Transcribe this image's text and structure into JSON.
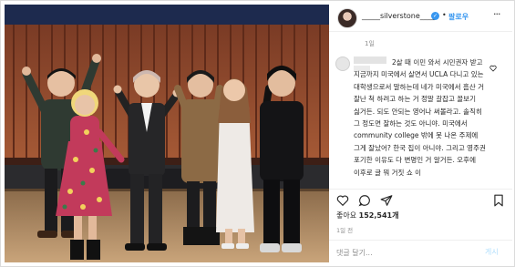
{
  "header": {
    "username": "_____silverstone____",
    "verified_icon": "verified-badge-icon",
    "separator": "•",
    "follow_label": "팔로우",
    "more_icon": "more-options-icon",
    "more_glyph": "···"
  },
  "time_top": "1일",
  "comment": {
    "text": "2살 때 이민 와서 시민권자 받고 지금까지 미국에서 살면서 UCLA 다니고 있는 대학생으로서 말하는데 네가 미국에서 흠산 거 잘난 척 하려고 하는 거 정말 갈잡고 꼴보기 싫거든. 되도 안되는 영어나 써볼라고. 솔직히 그 정도면 잘하는 것도 아니야. 미국에서 community college 밖에 못 나온 주제에 그게 잘났어? 한국 집이 아니야. 그리고 영주권 포기한 이유도 다 변명인 거 알거든. 오후에 이후로 글 뭐 거짓 쇼 이",
    "heart_icon": "heart-outline-icon"
  },
  "actions": {
    "like_icon": "heart-icon",
    "comment_icon": "comment-bubble-icon",
    "share_icon": "paper-plane-icon",
    "save_icon": "bookmark-icon"
  },
  "likes": {
    "prefix": "좋아요",
    "count": "152,541개"
  },
  "time_bottom": "1일 전",
  "add_comment": {
    "placeholder": "댓글 달기...",
    "post_label": "게시"
  },
  "colors": {
    "accent": "#3897f0",
    "post_disabled": "#b2dffc",
    "muted": "#8e8e8e",
    "border": "#dbdbdb"
  }
}
